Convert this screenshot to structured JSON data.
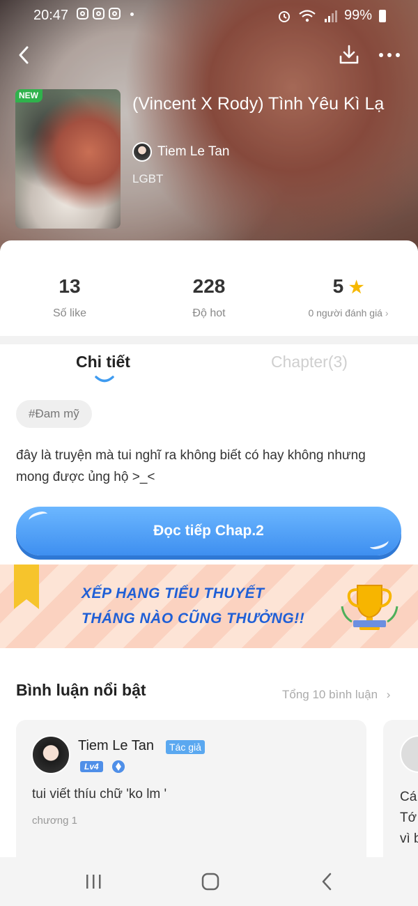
{
  "status_bar": {
    "time": "20:47",
    "battery": "99%"
  },
  "header": {
    "badge_new": "NEW",
    "title": "(Vincent X Rody) Tình Yêu Kì Lạ",
    "author": "Tiem Le Tan",
    "genre": "LGBT"
  },
  "stats": [
    {
      "value": "13",
      "label": "Số like"
    },
    {
      "value": "228",
      "label": "Độ hot"
    },
    {
      "value": "5",
      "label": "0 người đánh giá"
    }
  ],
  "tabs": [
    {
      "label": "Chi tiết",
      "active": true
    },
    {
      "label": "Chapter(3)",
      "active": false
    }
  ],
  "tag": "#Đam mỹ",
  "description": "đây là truyện mà tui nghĩ ra không biết có hay không nhưng mong được ủng hộ >_<",
  "cta_label": "Đọc tiếp Chap.2",
  "banner": {
    "line1": "XẾP HẠNG TIỂU THUYẾT",
    "line2": "THÁNG NÀO CŨNG THƯỞNG!!"
  },
  "comments": {
    "heading": "Bình luận nổi bật",
    "total": "Tổng 10 bình luận",
    "items": [
      {
        "user": "Tiem Le Tan",
        "badge": "Tác giả",
        "level": "Lv4",
        "text": "tui viết thíu chữ 'ko lm '",
        "meta": "chương 1"
      },
      {
        "text_lines": [
          "Cá",
          "Tớ",
          "vì b"
        ]
      }
    ]
  },
  "colors": {
    "accent": "#4f8fe8",
    "star": "#f6b800",
    "new_badge": "#2fb24c"
  }
}
